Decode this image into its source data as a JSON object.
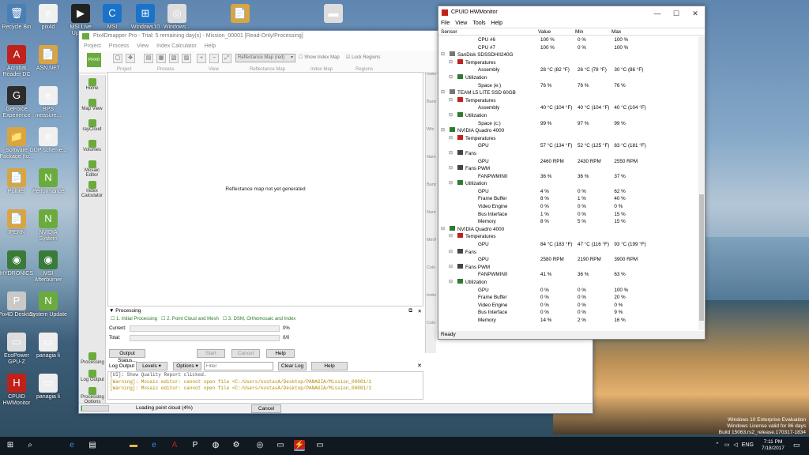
{
  "desktop": {
    "icons": [
      {
        "label": "Recycle Bin",
        "glyph": "🗑",
        "color": "#4a7fb5"
      },
      {
        "label": "Acrobat Reader DC",
        "glyph": "A",
        "color": "#c0211b"
      },
      {
        "label": "GeForce Experience",
        "glyph": "G",
        "color": "#2c2c2c"
      },
      {
        "label": "Software Package (to...",
        "glyph": "📁",
        "color": "#d9a441"
      },
      {
        "label": "Pointer",
        "glyph": "📄",
        "color": "#d9a441"
      },
      {
        "label": "IPERN",
        "glyph": "📄",
        "color": "#d9a441"
      },
      {
        "label": "HYDRONICS",
        "glyph": "◉",
        "color": "#3a7a3a"
      },
      {
        "label": "Pix4D Desktop",
        "glyph": "P",
        "color": "#c9c9c9"
      },
      {
        "label": "EcoPower GPU-Z",
        "glyph": "▭",
        "color": "#ddd"
      },
      {
        "label": "CPUID HWMonitor",
        "glyph": "H",
        "color": "#c0211b"
      }
    ],
    "icons2": [
      {
        "label": "pix4d",
        "glyph": "e",
        "color": "#f0f0f0"
      },
      {
        "label": "ASN.NET",
        "glyph": "📄",
        "color": "#d9a441"
      },
      {
        "label": "BPS measure...",
        "glyph": "e",
        "color": "#f0f0f0"
      },
      {
        "label": "GDP scheme...",
        "glyph": "e",
        "color": "#f0f0f0"
      },
      {
        "label": "Performance",
        "glyph": "N",
        "color": "#6bab3e"
      },
      {
        "label": "NVIDIA System",
        "glyph": "N",
        "color": "#6bab3e"
      },
      {
        "label": "MSI Afterburner",
        "glyph": "◉",
        "color": "#3a7a3a"
      },
      {
        "label": "System Update",
        "glyph": "N",
        "color": "#6bab3e"
      },
      {
        "label": "panagia li",
        "glyph": "▭",
        "color": "#eee"
      },
      {
        "label": "panagia li",
        "glyph": "▭",
        "color": "#eee"
      }
    ],
    "top_icons": [
      {
        "label": "MSI Live Update",
        "glyph": "▶",
        "color": "#222"
      },
      {
        "label": "MSI",
        "glyph": "C",
        "color": "#1a73c9"
      },
      {
        "label": "Windows10",
        "glyph": "⊞",
        "color": "#1a73c9"
      },
      {
        "label": "Windows...",
        "glyph": "◎",
        "color": "#ddd"
      },
      {
        "label": "",
        "glyph": "📄",
        "color": "#d9a441"
      },
      {
        "label": "",
        "glyph": "▬",
        "color": "#ddd"
      }
    ],
    "watermark": {
      "line1": "Windows 10 Enterprise Evaluation",
      "line2": "Windows License valid for 86 days",
      "line3": "Build 15063.rs2_release.170317-1834"
    }
  },
  "pix4d": {
    "title": "Pix4Dmapper Pro - Trial: 5 remaining day(s) - Mission_00001 [Read-Only/Processing]",
    "menu": [
      "Project",
      "Process",
      "View",
      "Index Calculator",
      "Help"
    ],
    "ribbon_groups": [
      "Project",
      "Process",
      "View",
      "Reflectance Map",
      "Index Map",
      "Regions"
    ],
    "reflectance_select": "Reflectance Map (red)",
    "show_index_map": "Show Index Map",
    "lock_regions": "Lock Regions",
    "sidebar": [
      "Home",
      "Map View",
      "rayCloud",
      "Volumes",
      "Mosaic Editor",
      "Index Calculator"
    ],
    "sidebar_bottom": [
      "Processing",
      "Log Output",
      "Processing Options"
    ],
    "viewport_text": "Reflectance map not yet generated",
    "processing": {
      "header": "Processing",
      "step1": "1. Initial Processing",
      "step2": "2. Point Cloud and Mesh",
      "step3": "3. DSM, Orthomosaic and Index",
      "current_label": "Current:",
      "current_val": "0%",
      "total_label": "Total:",
      "total_val": "0/0",
      "output_status": "Output Status...",
      "start": "Start",
      "cancel": "Cancel",
      "help": "Help"
    },
    "log": {
      "title": "Log Output",
      "levels": "Levels",
      "options": "Options",
      "filter_placeholder": "Filter",
      "clear": "Clear Log",
      "help": "Help",
      "lines": [
        "[UI]: Show Quality Report clicked.",
        "[Warning]: Mosaic editor: cannot open file <C:/Users/kostasA/Desktop/PANAGIA/Mission_00001/1",
        "[Warning]: Mosaic editor: cannot open file <C:/Users/kostasA/Desktop/PANAGIA/Mission_00001/1"
      ]
    },
    "status": {
      "text": "Loading point cloud (4%)",
      "cancel": "Cancel",
      "progress": 0.04
    },
    "right_panel": [
      "Index",
      "Band",
      "Whi",
      "Nam",
      "Band",
      "Numb",
      "Min/M",
      "Colo",
      "Index",
      "Colo"
    ]
  },
  "hwmon": {
    "title": "CPUID HWMonitor",
    "menu": [
      "File",
      "View",
      "Tools",
      "Help"
    ],
    "columns": [
      "Sensor",
      "Value",
      "Min",
      "Max"
    ],
    "status": "Ready",
    "rows": [
      {
        "lvl": 3,
        "name": "CPU #6",
        "v": "100 %",
        "mn": "0 %",
        "mx": "100 %"
      },
      {
        "lvl": 3,
        "name": "CPU #7",
        "v": "100 %",
        "mn": "0 %",
        "mx": "100 %"
      },
      {
        "lvl": 1,
        "name": "SanDisk SDSSDHII240G",
        "v": "",
        "mn": "",
        "mx": "",
        "ic": "d"
      },
      {
        "lvl": 2,
        "name": "Temperatures",
        "v": "",
        "mn": "",
        "mx": "",
        "ic": "t"
      },
      {
        "lvl": 3,
        "name": "Assembly",
        "v": "28 °C (82 °F)",
        "mn": "26 °C (78 °F)",
        "mx": "30 °C (86 °F)"
      },
      {
        "lvl": 2,
        "name": "Utilization",
        "v": "",
        "mn": "",
        "mx": "",
        "ic": "u"
      },
      {
        "lvl": 3,
        "name": "Space (e:)",
        "v": "76 %",
        "mn": "76 %",
        "mx": "76 %"
      },
      {
        "lvl": 1,
        "name": "TEAM L5 LITE SSD 60GB",
        "v": "",
        "mn": "",
        "mx": "",
        "ic": "d"
      },
      {
        "lvl": 2,
        "name": "Temperatures",
        "v": "",
        "mn": "",
        "mx": "",
        "ic": "t"
      },
      {
        "lvl": 3,
        "name": "Assembly",
        "v": "40 °C (104 °F)",
        "mn": "40 °C (104 °F)",
        "mx": "40 °C (104 °F)"
      },
      {
        "lvl": 2,
        "name": "Utilization",
        "v": "",
        "mn": "",
        "mx": "",
        "ic": "u"
      },
      {
        "lvl": 3,
        "name": "Space (c:)",
        "v": "99 %",
        "mn": "97 %",
        "mx": "99 %"
      },
      {
        "lvl": 1,
        "name": "NVIDIA Quadro 4000",
        "v": "",
        "mn": "",
        "mx": "",
        "ic": "g"
      },
      {
        "lvl": 2,
        "name": "Temperatures",
        "v": "",
        "mn": "",
        "mx": "",
        "ic": "t"
      },
      {
        "lvl": 3,
        "name": "GPU",
        "v": "57 °C (134 °F)",
        "mn": "52 °C (125 °F)",
        "mx": "83 °C (181 °F)"
      },
      {
        "lvl": 2,
        "name": "Fans",
        "v": "",
        "mn": "",
        "mx": "",
        "ic": "f"
      },
      {
        "lvl": 3,
        "name": "GPU",
        "v": "2460 RPM",
        "mn": "2430 RPM",
        "mx": "2550 RPM"
      },
      {
        "lvl": 2,
        "name": "Fans PWM",
        "v": "",
        "mn": "",
        "mx": "",
        "ic": "f"
      },
      {
        "lvl": 3,
        "name": "FANPWMIN0",
        "v": "36 %",
        "mn": "36 %",
        "mx": "37 %"
      },
      {
        "lvl": 2,
        "name": "Utilization",
        "v": "",
        "mn": "",
        "mx": "",
        "ic": "u"
      },
      {
        "lvl": 3,
        "name": "GPU",
        "v": "4 %",
        "mn": "0 %",
        "mx": "62 %"
      },
      {
        "lvl": 3,
        "name": "Frame Buffer",
        "v": "8 %",
        "mn": "1 %",
        "mx": "40 %"
      },
      {
        "lvl": 3,
        "name": "Video Engine",
        "v": "0 %",
        "mn": "0 %",
        "mx": "0 %"
      },
      {
        "lvl": 3,
        "name": "Bus Interface",
        "v": "1 %",
        "mn": "0 %",
        "mx": "15 %"
      },
      {
        "lvl": 3,
        "name": "Memory",
        "v": "8 %",
        "mn": "5 %",
        "mx": "15 %"
      },
      {
        "lvl": 1,
        "name": "NVIDIA Quadro 4000",
        "v": "",
        "mn": "",
        "mx": "",
        "ic": "g"
      },
      {
        "lvl": 2,
        "name": "Temperatures",
        "v": "",
        "mn": "",
        "mx": "",
        "ic": "t"
      },
      {
        "lvl": 3,
        "name": "GPU",
        "v": "84 °C (183 °F)",
        "mn": "47 °C (116 °F)",
        "mx": "93 °C (199 °F)"
      },
      {
        "lvl": 2,
        "name": "Fans",
        "v": "",
        "mn": "",
        "mx": "",
        "ic": "f"
      },
      {
        "lvl": 3,
        "name": "GPU",
        "v": "2580 RPM",
        "mn": "2190 RPM",
        "mx": "3900 RPM"
      },
      {
        "lvl": 2,
        "name": "Fans PWM",
        "v": "",
        "mn": "",
        "mx": "",
        "ic": "f"
      },
      {
        "lvl": 3,
        "name": "FANPWMIN0",
        "v": "41 %",
        "mn": "36 %",
        "mx": "63 %"
      },
      {
        "lvl": 2,
        "name": "Utilization",
        "v": "",
        "mn": "",
        "mx": "",
        "ic": "u"
      },
      {
        "lvl": 3,
        "name": "GPU",
        "v": "0 %",
        "mn": "0 %",
        "mx": "100 %"
      },
      {
        "lvl": 3,
        "name": "Frame Buffer",
        "v": "0 %",
        "mn": "0 %",
        "mx": "20 %"
      },
      {
        "lvl": 3,
        "name": "Video Engine",
        "v": "0 %",
        "mn": "0 %",
        "mx": "0 %"
      },
      {
        "lvl": 3,
        "name": "Bus Interface",
        "v": "0 %",
        "mn": "0 %",
        "mx": "9 %"
      },
      {
        "lvl": 3,
        "name": "Memory",
        "v": "14 %",
        "mn": "2 %",
        "mx": "16 %"
      }
    ]
  },
  "taskbar": {
    "time": "7:11 PM",
    "date": "7/18/2017",
    "lang": "ENG"
  }
}
